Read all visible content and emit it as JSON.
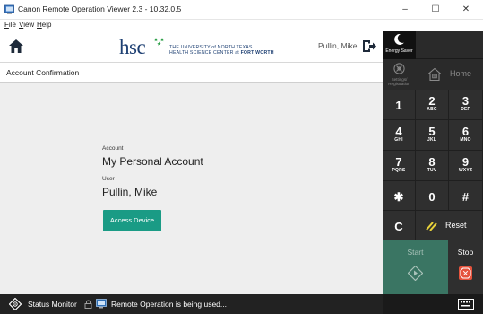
{
  "window": {
    "title": "Canon Remote Operation Viewer 2.3 - 10.32.0.5",
    "minimize": "–",
    "maximize": "☐",
    "close": "✕"
  },
  "menu": {
    "file": "File",
    "view": "View",
    "help": "Help"
  },
  "header": {
    "logo": {
      "mark": "hsc",
      "line1": "THE UNIVERSITY of NORTH TEXAS",
      "line2_a": "HEALTH SCIENCE CENTER at ",
      "line2_b": "FORT WORTH"
    },
    "user": "Pullin, Mike"
  },
  "page": {
    "title": "Account Confirmation",
    "account_label": "Account",
    "account_value": "My Personal Account",
    "user_label": "User",
    "user_value": "Pullin, Mike",
    "access_button": "Access Device"
  },
  "panel": {
    "energy_saver": "Energy Saver",
    "settings_line1": "Settings/",
    "settings_line2": "Registration",
    "home": "Home",
    "keys": [
      {
        "num": "1",
        "sub": ""
      },
      {
        "num": "2",
        "sub": "ABC"
      },
      {
        "num": "3",
        "sub": "DEF"
      },
      {
        "num": "4",
        "sub": "GHI"
      },
      {
        "num": "5",
        "sub": "JKL"
      },
      {
        "num": "6",
        "sub": "MNO"
      },
      {
        "num": "7",
        "sub": "PQRS"
      },
      {
        "num": "8",
        "sub": "TUV"
      },
      {
        "num": "9",
        "sub": "WXYZ"
      },
      {
        "num": "✱",
        "sub": ""
      },
      {
        "num": "0",
        "sub": ""
      },
      {
        "num": "#",
        "sub": ""
      }
    ],
    "clear": "C",
    "reset": "Reset",
    "start": "Start",
    "stop": "Stop"
  },
  "status": {
    "monitor": "Status Monitor",
    "message": "Remote Operation is being used..."
  },
  "colors": {
    "accent": "#1a9b85",
    "brand": "#1d3f72",
    "start": "#3a7563",
    "stop_icon": "#e5533d",
    "reset_icon": "#e8d23a"
  }
}
